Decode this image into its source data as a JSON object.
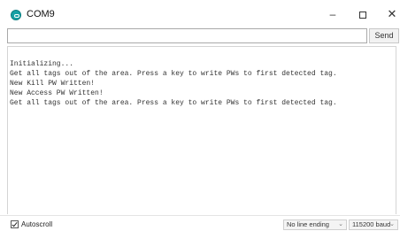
{
  "window": {
    "title": "COM9",
    "icon": "arduino-icon",
    "controls": {
      "minimize": "–",
      "close": "✕"
    }
  },
  "input": {
    "value": "",
    "placeholder": "",
    "send_label": "Send"
  },
  "output": {
    "lines": [
      "Initializing...",
      "Get all tags out of the area. Press a key to write PWs to first detected tag.",
      "New Kill PW Written!",
      "New Access PW Written!",
      "Get all tags out of the area. Press a key to write PWs to first detected tag."
    ]
  },
  "status": {
    "autoscroll_label": "Autoscroll",
    "autoscroll_checked": true,
    "line_ending": "No line ending",
    "baud_rate": "115200 baud"
  },
  "colors": {
    "accent": "#17a1a5"
  }
}
